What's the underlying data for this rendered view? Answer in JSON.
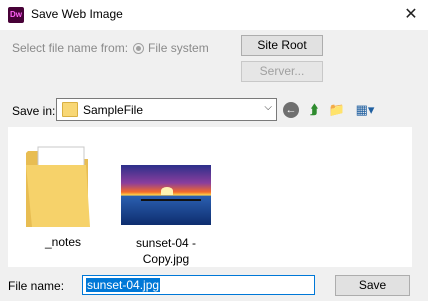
{
  "window": {
    "title": "Save Web Image",
    "app_icon": "Dw",
    "close_label": "✕"
  },
  "source": {
    "label": "Select file name from:",
    "option_label": "File system",
    "site_root_label": "Site Root",
    "server_label": "Server..."
  },
  "save_in": {
    "label": "Save in:",
    "folder": "SampleFile"
  },
  "files": [
    {
      "name": "_notes",
      "icon": "folder-icon"
    },
    {
      "name_line1": "sunset-04 -",
      "name_line2": "Copy.jpg",
      "icon": "image-thumbnail"
    }
  ],
  "file_name": {
    "label": "File name:",
    "value": "sunset-04.jpg"
  },
  "actions": {
    "save_label": "Save"
  },
  "colors": {
    "accent": "#0078d7",
    "app_icon_bg": "#470137"
  }
}
